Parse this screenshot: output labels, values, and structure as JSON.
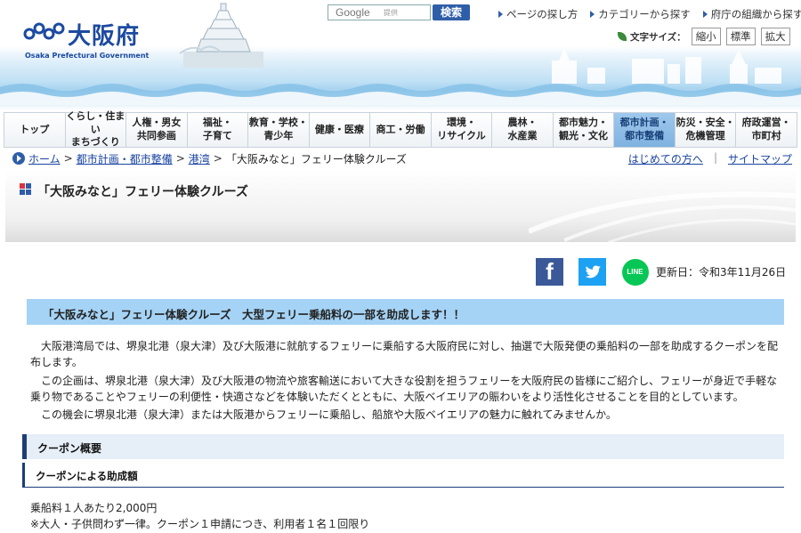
{
  "header": {
    "logo_text": "大阪府",
    "logo_sub": "Osaka Prefectural Government",
    "search": {
      "google_label": "Google",
      "sub_label": "提供",
      "button": "検索"
    },
    "util_links": [
      "ページの探し方",
      "カテゴリーから探す",
      "府庁の組織から探す"
    ],
    "font_size": {
      "label": "文字サイズ：",
      "small": "縮小",
      "standard": "標準",
      "large": "拡大"
    }
  },
  "nav": [
    {
      "label": "トップ",
      "active": false
    },
    {
      "label": "くらし・住まい\nまちづくり",
      "active": false
    },
    {
      "label": "人権・男女\n共同参画",
      "active": false
    },
    {
      "label": "福祉・\n子育て",
      "active": false
    },
    {
      "label": "教育・学校・\n青少年",
      "active": false
    },
    {
      "label": "健康・医療",
      "active": false
    },
    {
      "label": "商工・労働",
      "active": false
    },
    {
      "label": "環境・\nリサイクル",
      "active": false
    },
    {
      "label": "農林・\n水産業",
      "active": false
    },
    {
      "label": "都市魅力・\n観光・文化",
      "active": false
    },
    {
      "label": "都市計画・\n都市整備",
      "active": true
    },
    {
      "label": "防災・安全・\n危機管理",
      "active": false
    },
    {
      "label": "府政運営・\n市町村",
      "active": false
    }
  ],
  "breadcrumb": {
    "items": [
      "ホーム",
      "都市計画・都市整備",
      "港湾"
    ],
    "separator": ">",
    "current": "「大阪みなと」フェリー体験クルーズ",
    "right_links": [
      "はじめての方へ",
      "サイトマップ"
    ],
    "divider": "|"
  },
  "page_title": "「大阪みなと」フェリー体験クルーズ",
  "share": {
    "facebook_glyph": "f",
    "twitter_glyph": "t",
    "line_label": "LINE"
  },
  "updated": "更新日：令和3年11月26日",
  "content": {
    "heading": "「大阪みなと」フェリー体験クルーズ　大型フェリー乗船料の一部を助成します！！",
    "paragraphs": [
      "　大阪港湾局では、堺泉北港（泉大津）及び大阪港に就航するフェリーに乗船する大阪府民に対し、抽選で大阪発便の乗船料の一部を助成するクーポンを配布します。",
      "　この企画は、堺泉北港（泉大津）及び大阪港の物流や旅客輸送において大きな役割を担うフェリーを大阪府民の皆様にご紹介し、フェリーが身近で手軽な乗り物であることやフェリーの利便性・快適さなどを体験いただくとともに、大阪ベイエリアの賑わいをより活性化させることを目的としています。",
      "　この機会に堺泉北港（泉大津）または大阪港からフェリーに乗船し、船旅や大阪ベイエリアの魅力に触れてみませんか。"
    ],
    "section_heading": "クーポン概要",
    "subsection_heading": "クーポンによる助成額",
    "details": [
      "乗船料１人あたり2,000円",
      "※大人・子供問わず一律。クーポン１申請につき、利用者１名１回限り"
    ]
  }
}
